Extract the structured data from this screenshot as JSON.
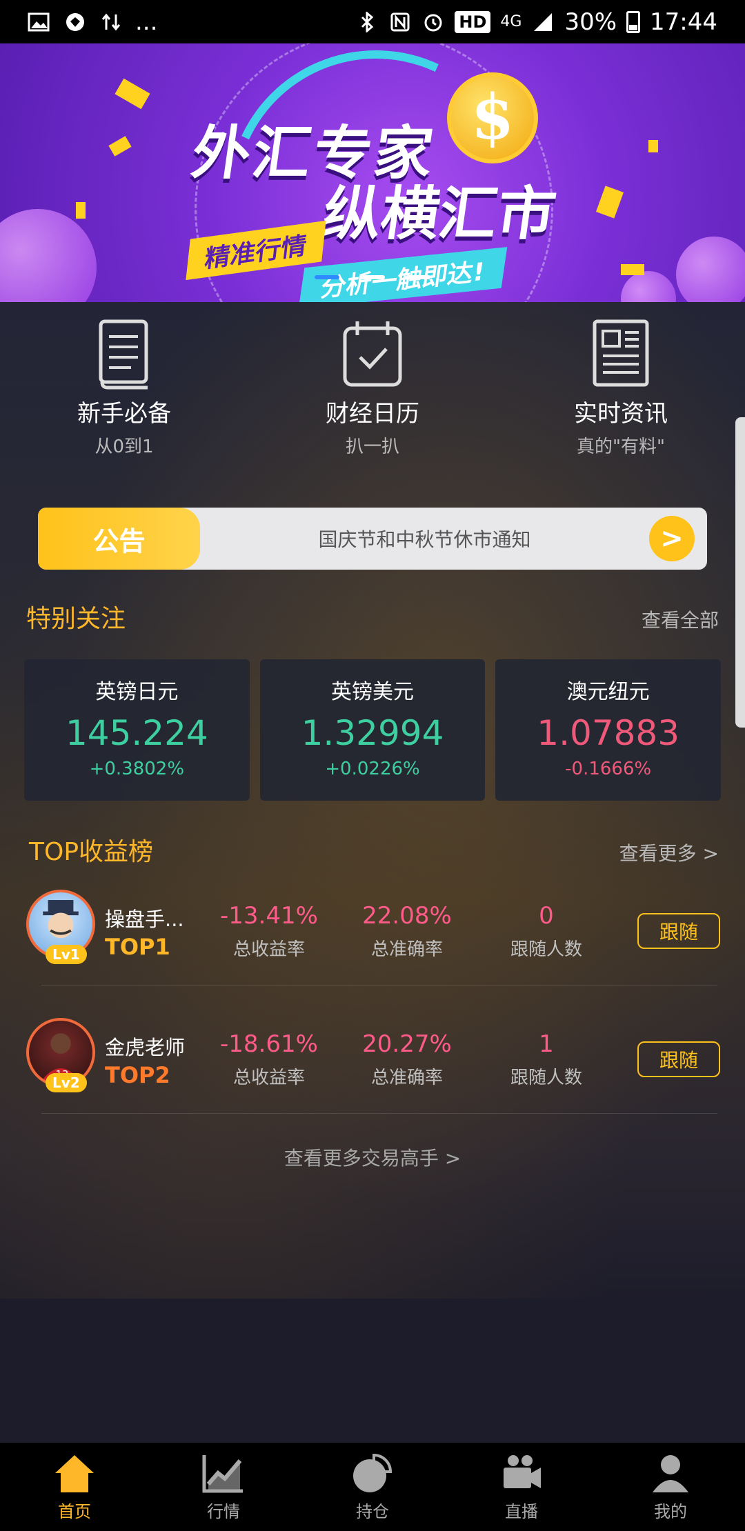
{
  "statusbar": {
    "battery": "30%",
    "time": "17:44",
    "network": "4G",
    "hd": "HD",
    "dots": "..."
  },
  "banner": {
    "title1": "外汇专家",
    "title2": "纵横汇市",
    "tag1": "精准行情",
    "tag2": "分析一触即达!",
    "coin_symbol": "$",
    "page_count": 3,
    "active_page": 1
  },
  "quick_links": [
    {
      "icon": "book-icon",
      "title": "新手必备",
      "subtitle": "从0到1"
    },
    {
      "icon": "calendar-icon",
      "title": "财经日历",
      "subtitle": "扒一扒"
    },
    {
      "icon": "newspaper-icon",
      "title": "实时资讯",
      "subtitle": "真的\"有料\""
    }
  ],
  "notice": {
    "tag": "公告",
    "text": "国庆节和中秋节休市通知",
    "arrow": ">"
  },
  "special": {
    "heading": "特别关注",
    "view_all": "查看全部",
    "cards": [
      {
        "name": "英镑日元",
        "price": "145.224",
        "change": "+0.3802%",
        "direction": "up"
      },
      {
        "name": "英镑美元",
        "price": "1.32994",
        "change": "+0.0226%",
        "direction": "up"
      },
      {
        "name": "澳元纽元",
        "price": "1.07883",
        "change": "-0.1666%",
        "direction": "down"
      }
    ]
  },
  "top": {
    "heading": "TOP收益榜",
    "view_more": "查看更多 >",
    "labels": {
      "return": "总收益率",
      "accuracy": "总准确率",
      "followers": "跟随人数",
      "follow": "跟随"
    },
    "traders": [
      {
        "name": "操盘手...",
        "rank": "TOP1",
        "level": "Lv1",
        "return": "-13.41%",
        "accuracy": "22.08%",
        "followers": "0"
      },
      {
        "name": "金虎老师",
        "rank": "TOP2",
        "level": "Lv2",
        "return": "-18.61%",
        "accuracy": "20.27%",
        "followers": "1"
      }
    ],
    "more_traders": "查看更多交易高手 >"
  },
  "tabs": [
    {
      "label": "首页",
      "icon": "home-icon",
      "active": true
    },
    {
      "label": "行情",
      "icon": "chart-icon",
      "active": false
    },
    {
      "label": "持仓",
      "icon": "pie-icon",
      "active": false
    },
    {
      "label": "直播",
      "icon": "video-icon",
      "active": false
    },
    {
      "label": "我的",
      "icon": "user-icon",
      "active": false
    }
  ],
  "colors": {
    "accent": "#ffb72a",
    "up": "#3ecfa0",
    "down": "#ef5a7a",
    "banner": "#7a2fd6"
  }
}
